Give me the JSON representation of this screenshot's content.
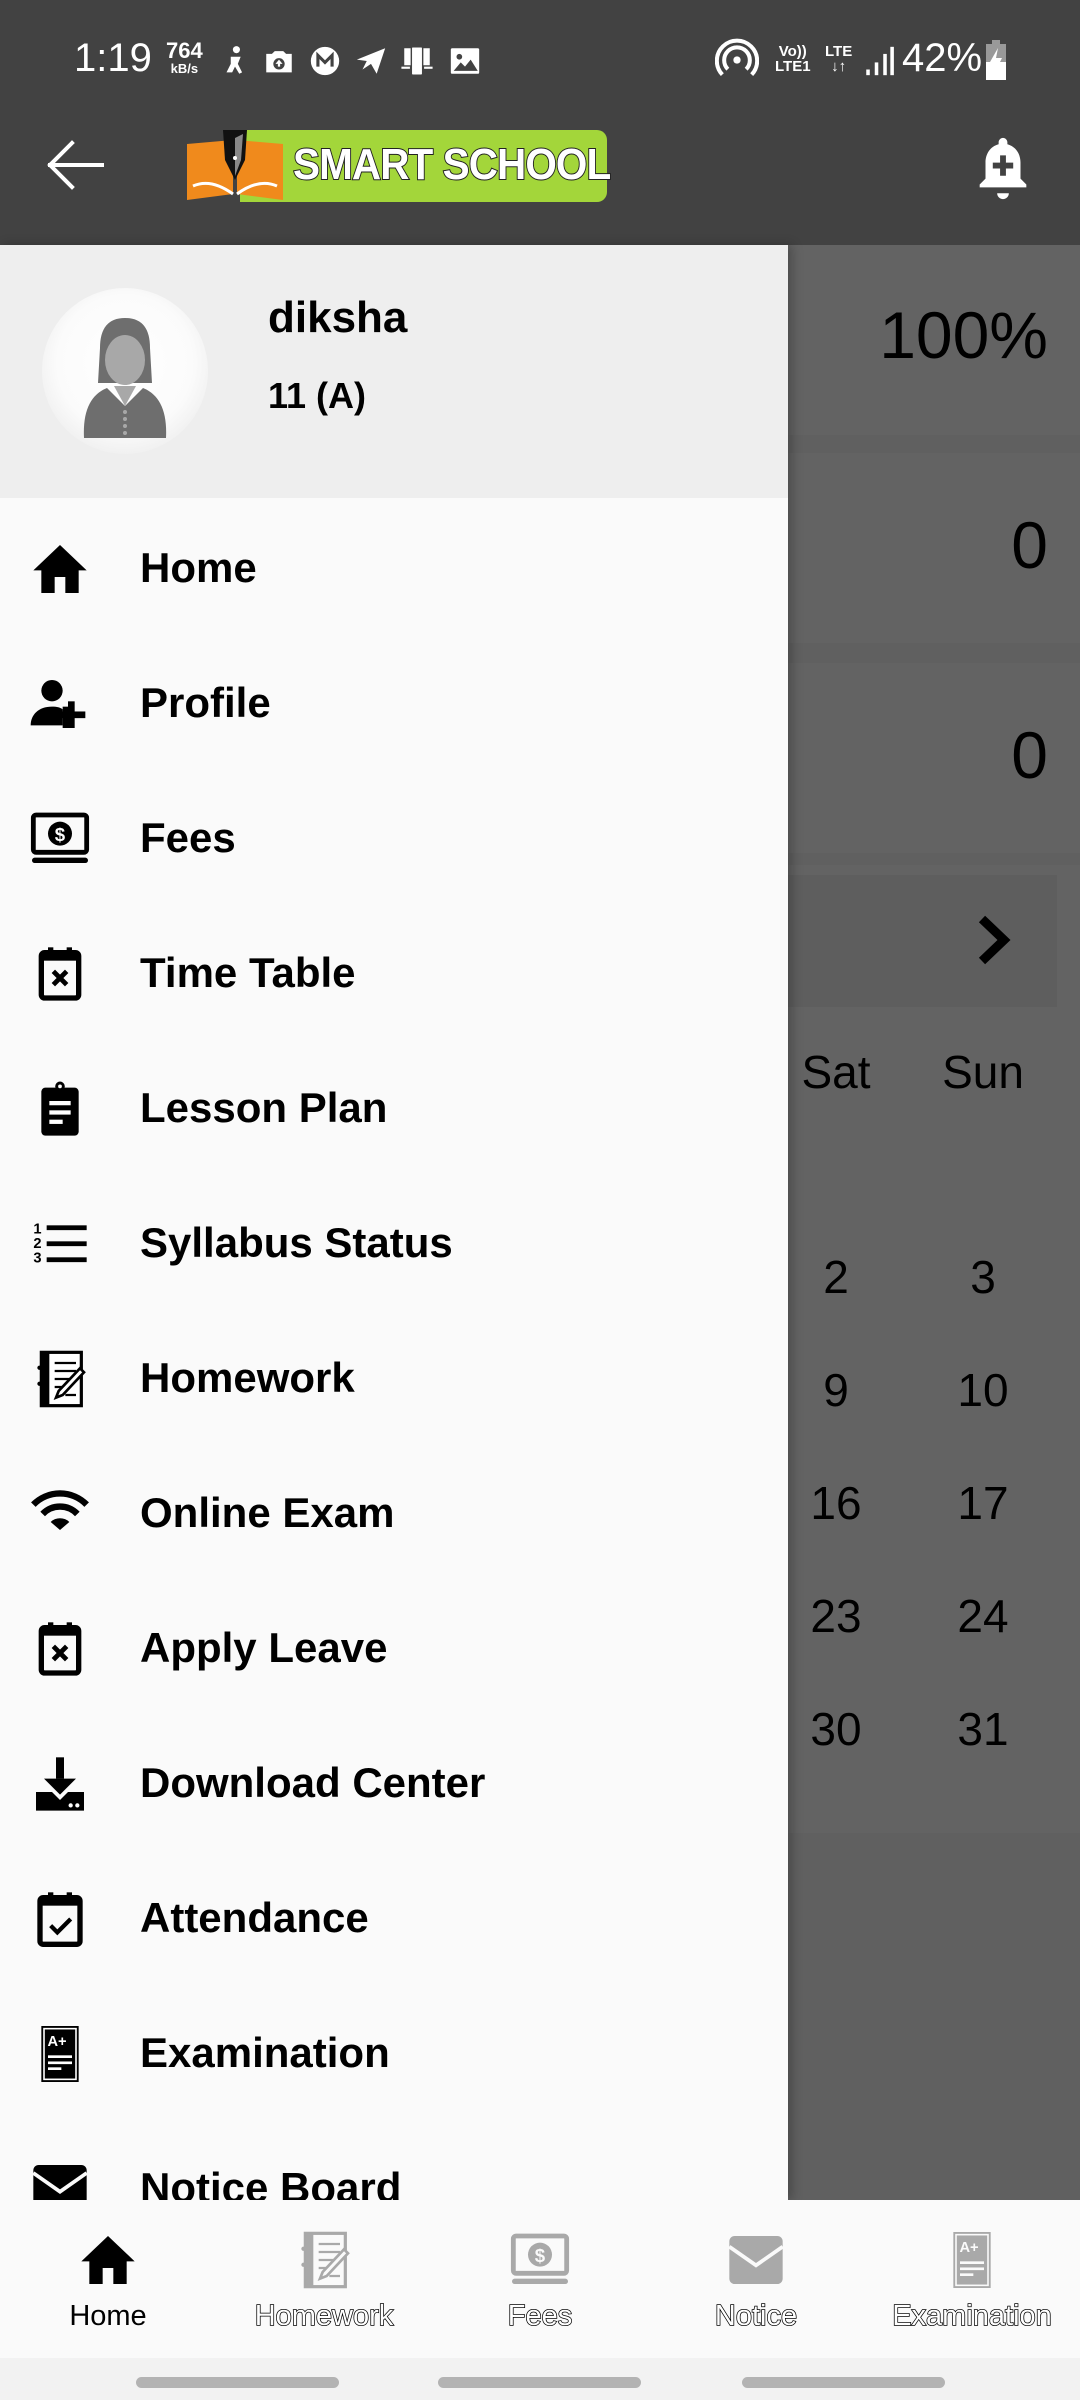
{
  "status_bar": {
    "time": "1:19",
    "net_speed_value": "764",
    "net_speed_unit": "kB/s",
    "notification_icons": [
      "accessibility-icon",
      "camera-upload-icon",
      "mega-icon",
      "telegram-icon",
      "phone-link-icon",
      "gallery-icon"
    ],
    "hotspot_icon": "hotspot-icon",
    "volte_top": "Vo))",
    "volte_bottom": "LTE1",
    "lte_label": "LTE",
    "lte_arrows": "↓↑",
    "signal_icon": "signal-icon",
    "battery_percent": "42%",
    "battery_icon": "battery-charging-icon"
  },
  "app_bar": {
    "back_icon": "arrow-back-icon",
    "logo_text": "SMART SCHOOL",
    "notification_icon": "bell-plus-icon",
    "colors": {
      "bar": "#424242",
      "logo_green": "#a3d63a",
      "logo_orange": "#f08a1c"
    }
  },
  "dashboard": {
    "stats": [
      "100%",
      "0",
      "0"
    ],
    "calendar": {
      "next_icon": "chevron-right-icon",
      "weekday_headers": [
        "Sat",
        "Sun"
      ],
      "rows": [
        [
          "2",
          "3"
        ],
        [
          "9",
          "10"
        ],
        [
          "16",
          "17"
        ],
        [
          "23",
          "24"
        ],
        [
          "30",
          "31"
        ]
      ]
    }
  },
  "drawer": {
    "user": {
      "name": "diksha",
      "class_section": "11 (A)",
      "avatar_icon": "female-avatar-icon"
    },
    "items": [
      {
        "label": "Home",
        "icon": "home-icon"
      },
      {
        "label": "Profile",
        "icon": "person-add-icon"
      },
      {
        "label": "Fees",
        "icon": "fees-laptop-dollar-icon"
      },
      {
        "label": "Time Table",
        "icon": "calendar-x-icon"
      },
      {
        "label": "Lesson Plan",
        "icon": "clipboard-icon"
      },
      {
        "label": "Syllabus Status",
        "icon": "numbered-list-icon"
      },
      {
        "label": "Homework",
        "icon": "notebook-pencil-icon"
      },
      {
        "label": "Online Exam",
        "icon": "wifi-icon"
      },
      {
        "label": "Apply Leave",
        "icon": "calendar-x-icon"
      },
      {
        "label": "Download Center",
        "icon": "download-tray-icon"
      },
      {
        "label": "Attendance",
        "icon": "calendar-check-icon"
      },
      {
        "label": "Examination",
        "icon": "grade-sheet-icon"
      },
      {
        "label": "Notice Board",
        "icon": "envelope-icon"
      }
    ]
  },
  "bottom_nav": {
    "items": [
      {
        "label": "Home",
        "icon": "home-icon",
        "active": true
      },
      {
        "label": "Homework",
        "icon": "notebook-pencil-icon",
        "active": false
      },
      {
        "label": "Fees",
        "icon": "fees-laptop-dollar-icon",
        "active": false
      },
      {
        "label": "Notice",
        "icon": "envelope-icon",
        "active": false
      },
      {
        "label": "Examination",
        "icon": "grade-sheet-icon",
        "active": false
      }
    ],
    "colors": {
      "active": "#000000",
      "inactive": "#a9a9a9"
    }
  }
}
